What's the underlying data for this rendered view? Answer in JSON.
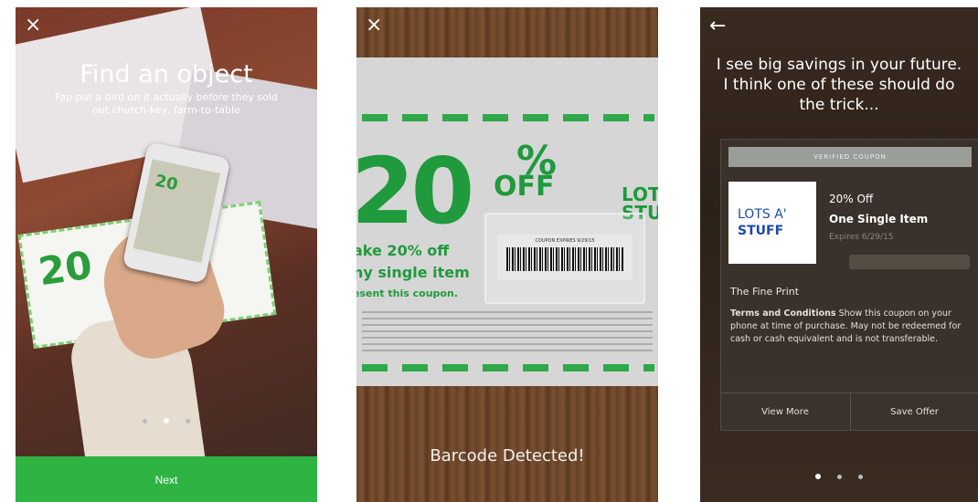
{
  "screen1": {
    "title": "Find an object",
    "subtitle": "Fap put a bird on it actually before they sold out church-key, farm-to-table",
    "next_label": "Next",
    "coupon_number": "20",
    "close_icon": "×"
  },
  "screen2": {
    "big_number": "20",
    "percent": "%",
    "off": "OFF",
    "brand_partial": "LOTS\nSTU",
    "line1": "ake 20% off",
    "line2": "ny single item",
    "line3": "esent this coupon.",
    "barcode_expires": "COUPON EXPIRES 9/29/15",
    "detected_label": "Barcode Detected!",
    "close_icon": "×"
  },
  "screen3": {
    "heading": "I see big savings in your future. I think one of these should do the trick...",
    "verified_label": "VERIFIED COUPON",
    "logo_line1": "LOTS A'",
    "logo_line2": "STUFF",
    "offer_pct": "20% Off",
    "offer_item": "One Single Item",
    "offer_expires": "Expires 6/29/15",
    "fineprint_title": "The Fine Print",
    "terms_bold": "Terms and Conditions",
    "terms_text": " Show this coupon on your phone at time of purchase. May not be redeemed for cash or cash equivalent and is not transferable.",
    "view_more_label": "View More",
    "save_offer_label": "Save Offer",
    "back_icon": "←"
  },
  "colors": {
    "accent_green": "#2fb444",
    "coupon_green": "#1f9a3c",
    "logo_blue": "#1c4aa8"
  },
  "pagination": {
    "screen1_active": 2,
    "screen3_active": 1,
    "total": 3
  }
}
